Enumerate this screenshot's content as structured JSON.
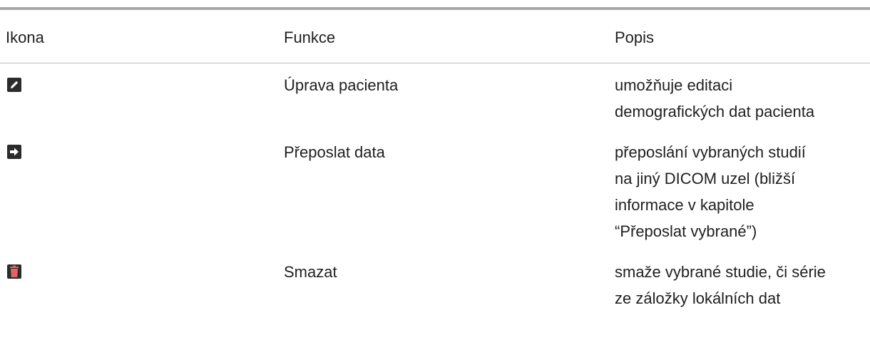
{
  "table": {
    "headers": {
      "icon": "Ikona",
      "function": "Funkce",
      "description": "Popis"
    },
    "rows": [
      {
        "icon_name": "edit-pencil-icon",
        "icon_color": "#2b2b2b",
        "function": "Úprava pacienta",
        "description_lines": [
          "umožňuje editaci",
          "demografických dat pacienta"
        ]
      },
      {
        "icon_name": "forward-arrow-icon",
        "icon_color": "#2b2b2b",
        "function": "Přeposlat data",
        "description_lines": [
          "přeposlání vybraných studií",
          "na jiný DICOM uzel (bližší",
          "informace v kapitole",
          "“Přeposlat vybrané”)"
        ]
      },
      {
        "icon_name": "trash-delete-icon",
        "icon_color": "#e06666",
        "function": "Smazat",
        "description_lines": [
          "smaže vybrané studie, či série",
          "ze záložky lokálních dat"
        ]
      }
    ]
  }
}
